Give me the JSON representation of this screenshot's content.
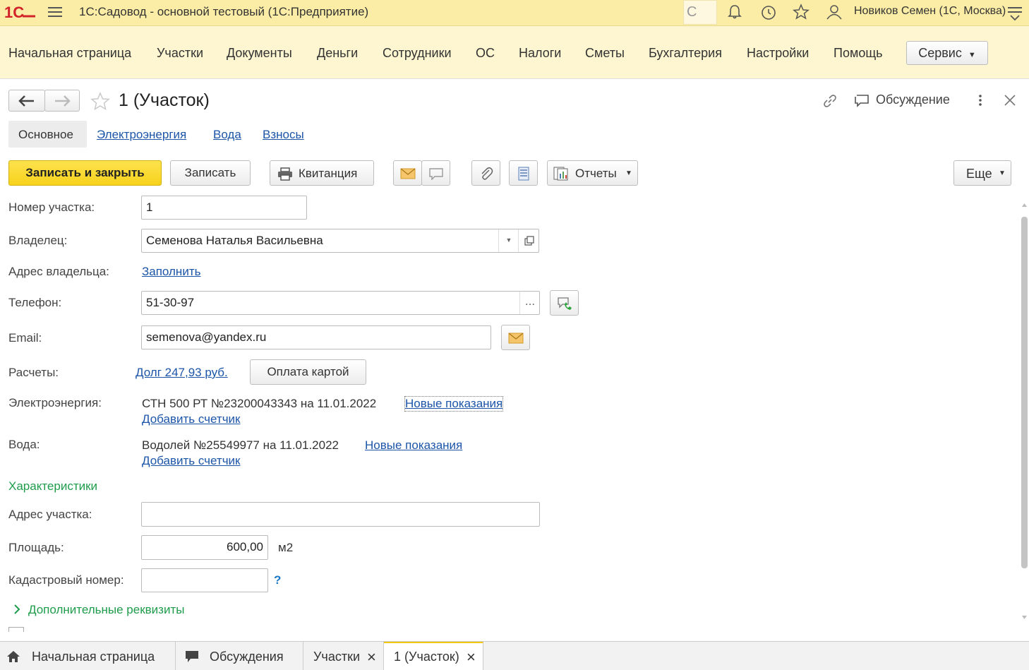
{
  "app": {
    "title": "1С:Садовод - основной тестовый  (1С:Предприятие)",
    "user": "Новиков Семен (1С, Москва)",
    "search_glyph": "С"
  },
  "menu": {
    "items": [
      "Начальная страница",
      "Участки",
      "Документы",
      "Деньги",
      "Сотрудники",
      "ОС",
      "Налоги",
      "Сметы",
      "Бухгалтерия",
      "Настройки",
      "Помощь"
    ],
    "service": "Сервис"
  },
  "form": {
    "title": "1 (Участок)",
    "discussion": "Обсуждение",
    "tabs": [
      "Основное",
      "Электроэнергия",
      "Вода",
      "Взносы"
    ]
  },
  "toolbar": {
    "save_close": "Записать и закрыть",
    "save": "Записать",
    "receipt": "Квитанция",
    "reports": "Отчеты",
    "more": "Еще"
  },
  "fields": {
    "plot_number_label": "Номер участка:",
    "plot_number": "1",
    "owner_label": "Владелец:",
    "owner": "Семенова Наталья Васильевна",
    "owner_address_label": "Адрес владельца:",
    "fill_link": "Заполнить",
    "phone_label": "Телефон:",
    "phone": "51-30-97",
    "phone_btn": "...",
    "email_label": "Email:",
    "email": "semenova@yandex.ru",
    "payments_label": "Расчеты:",
    "debt_link": "Долг 247,93 руб.",
    "card_pay": "Оплата картой",
    "electricity_label": "Электроэнергия:",
    "electricity_meter": "СТН 500 РТ №23200043343 на 11.01.2022",
    "new_readings": "Новые показания",
    "add_meter": "Добавить счетчик",
    "water_label": "Вода:",
    "water_meter": "Водолей №25549977 на 11.01.2022",
    "characteristics": "Характеристики",
    "plot_address_label": "Адрес участка:",
    "area_label": "Площадь:",
    "area": "600,00",
    "area_unit": "м2",
    "cadastral_label": "Кадастровый номер:",
    "cadastral_help": "?",
    "extra": "Дополнительные реквизиты"
  },
  "statusbar": {
    "home": "Начальная страница",
    "discussions": "Обсуждения",
    "plots": "Участки",
    "current": "1 (Участок)",
    "close_glyph": "×"
  },
  "colors": {
    "accent_yellow": "#f7d21c",
    "link": "#1c55a8",
    "green": "#1e9c4b"
  }
}
